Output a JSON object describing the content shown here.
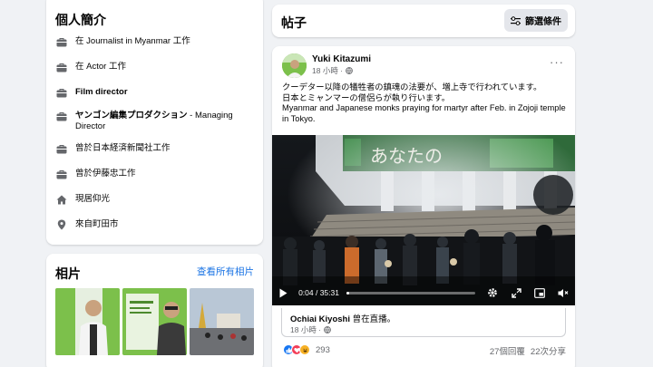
{
  "intro": {
    "title": "個人簡介",
    "items": [
      {
        "icon": "briefcase-icon",
        "prefix": "在",
        "bold": "Journalist in Myanmar",
        "suffix": "工作"
      },
      {
        "icon": "briefcase-icon",
        "prefix": "在",
        "bold": "Actor",
        "suffix": "工作"
      },
      {
        "icon": "briefcase-icon",
        "prefix": "",
        "bold": "Film director",
        "suffix": ""
      },
      {
        "icon": "briefcase-icon",
        "prefix": "",
        "bold": "ヤンゴン編集プロダクション",
        "suffix": "- Managing Director"
      },
      {
        "icon": "briefcase-icon",
        "prefix": "曾於",
        "bold": "日本経済新聞社",
        "suffix": "工作"
      },
      {
        "icon": "briefcase-icon",
        "prefix": "曾於",
        "bold": "伊藤忠",
        "suffix": "工作"
      },
      {
        "icon": "home-icon",
        "prefix": "現居",
        "bold": "仰光",
        "suffix": ""
      },
      {
        "icon": "location-pin-icon",
        "prefix": "來自",
        "bold": "町田市",
        "suffix": ""
      }
    ]
  },
  "photos": {
    "title": "相片",
    "see_all": "查看所有相片"
  },
  "posts": {
    "title": "帖子",
    "filter_label": "篩選條件"
  },
  "post": {
    "author": "Yuki Kitazumi",
    "time": "18 小時 ·",
    "more_label": "···",
    "text_line1": "クーデター以降の犠牲者の鎮魂の法要が、増上寺で行われています。",
    "text_line2": "日本とミャンマーの僧侶らが執り行います。",
    "text_line3": "Myanmar and Japanese monks praying for martyr after Feb. in Zojoji temple in Tokyo.",
    "video": {
      "time": "0:04 / 35:31",
      "progress_fraction": 0.02
    },
    "shared_by": "Ochiai Kiyoshi",
    "shared_suffix": "曾在直播。",
    "shared_time": "18 小時 ·",
    "reaction_count": "293",
    "comments": "27個回覆",
    "shares": "22次分享"
  },
  "colors": {
    "background": "#f0f2f5",
    "link": "#1b74e4",
    "muted": "#65676b",
    "like": "#1877f2",
    "love": "#f33e58",
    "haha": "#f7b125"
  }
}
